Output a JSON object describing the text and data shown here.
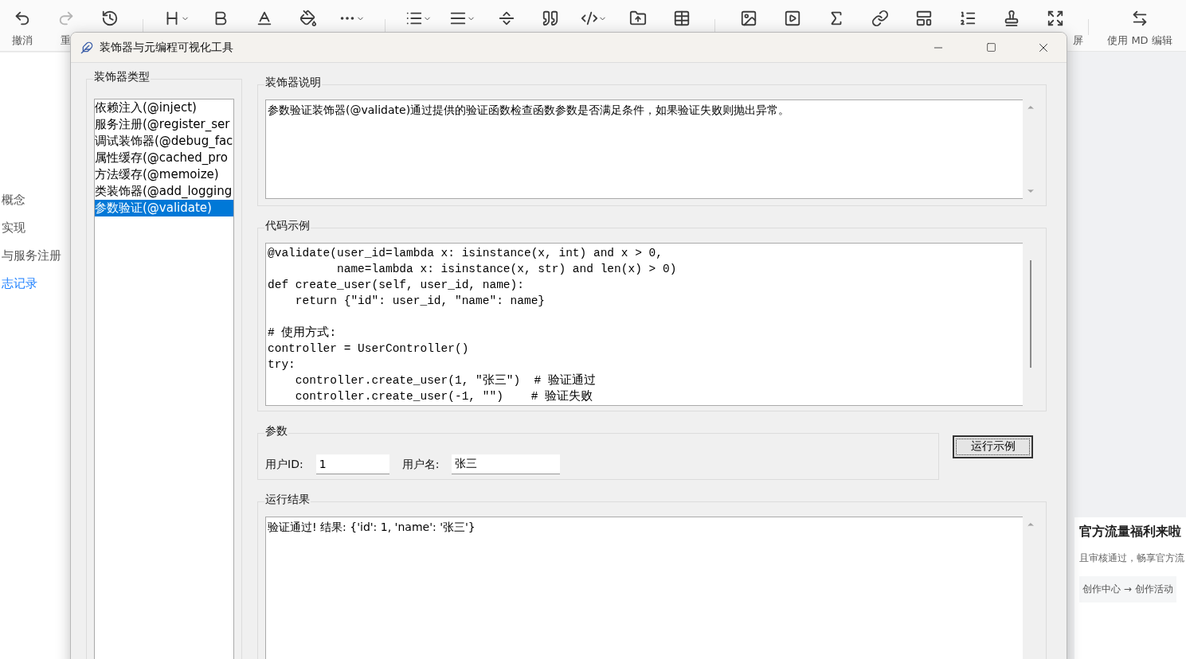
{
  "editor_toolbar": {
    "items": [
      {
        "kind": "undo",
        "label": "撤消",
        "disabled": false,
        "caret": false
      },
      {
        "kind": "redo",
        "label": "重",
        "disabled": true,
        "caret": false
      },
      {
        "kind": "history",
        "disabled": false,
        "caret": false
      },
      {
        "kind": "divider"
      },
      {
        "kind": "heading",
        "disabled": false,
        "caret": true
      },
      {
        "kind": "bold",
        "disabled": false,
        "caret": false
      },
      {
        "kind": "text-color",
        "disabled": false,
        "caret": false
      },
      {
        "kind": "fill",
        "disabled": false,
        "caret": false
      },
      {
        "kind": "more",
        "disabled": false,
        "caret": true
      },
      {
        "kind": "divider"
      },
      {
        "kind": "list",
        "disabled": false,
        "caret": true
      },
      {
        "kind": "align",
        "disabled": false,
        "caret": true
      },
      {
        "kind": "rule",
        "disabled": false,
        "caret": false
      },
      {
        "kind": "quote",
        "disabled": false,
        "caret": false
      },
      {
        "kind": "code",
        "disabled": false,
        "caret": true
      },
      {
        "kind": "upload",
        "disabled": false,
        "caret": false
      },
      {
        "kind": "table",
        "disabled": false,
        "caret": false
      },
      {
        "kind": "divider"
      },
      {
        "kind": "image",
        "disabled": false,
        "caret": false
      },
      {
        "kind": "video",
        "disabled": false,
        "caret": false
      },
      {
        "kind": "formula",
        "disabled": false,
        "caret": false
      },
      {
        "kind": "link",
        "disabled": false,
        "caret": false
      },
      {
        "kind": "template",
        "disabled": false,
        "caret": false
      },
      {
        "kind": "ordered",
        "disabled": false,
        "caret": false
      },
      {
        "kind": "stamp",
        "disabled": false,
        "caret": false
      },
      {
        "kind": "fullscreen",
        "label": "屏",
        "disabled": false,
        "caret": false
      },
      {
        "kind": "divider"
      },
      {
        "kind": "swap",
        "label": "使用 MD 编辑",
        "disabled": false,
        "caret": false
      }
    ]
  },
  "sidebar": {
    "items": [
      {
        "label": "概念",
        "selected": false
      },
      {
        "label": "实现",
        "selected": false
      },
      {
        "label": "与服务注册",
        "selected": false
      },
      {
        "label": "志记录",
        "selected": true
      }
    ]
  },
  "promo": {
    "title": "官方流量福利来啦",
    "text": "且审核通过，畅享官方流",
    "path": "创作中心 → 创作活动"
  },
  "dialog": {
    "title": "装饰器与元编程可视化工具",
    "types": {
      "title": "装饰器类型",
      "items": [
        {
          "label": "依赖注入(@inject)",
          "selected": false
        },
        {
          "label": "服务注册(@register_ser",
          "selected": false
        },
        {
          "label": "调试装饰器(@debug_fac",
          "selected": false
        },
        {
          "label": "属性缓存(@cached_pro",
          "selected": false
        },
        {
          "label": "方法缓存(@memoize)",
          "selected": false
        },
        {
          "label": "类装饰器(@add_logging",
          "selected": false
        },
        {
          "label": "参数验证(@validate)",
          "selected": true
        }
      ]
    },
    "description": {
      "title": "装饰器说明",
      "text": "参数验证装饰器(@validate)通过提供的验证函数检查函数参数是否满足条件，如果验证失败则抛出异常。"
    },
    "code": {
      "title": "代码示例",
      "blocks": [
        [
          "@validate(user_id=lambda x: isinstance(x, int) and x > 0,",
          "          name=lambda x: isinstance(x, str) and len(x) > 0)",
          "def create_user(self, user_id, name):",
          "    return {\"id\": user_id, \"name\": name}"
        ],
        [
          "# 使用方式:",
          "controller = UserController()",
          "try:",
          "    controller.create_user(1, \"张三\")  # 验证通过",
          "    controller.create_user(-1, \"\")    # 验证失败"
        ]
      ]
    },
    "params": {
      "title": "参数",
      "fields": [
        {
          "label": "用户ID:",
          "value": "1"
        },
        {
          "label": "用户名:",
          "value": "张三"
        }
      ]
    },
    "run_button": "运行示例",
    "result": {
      "title": "运行结果",
      "text": "验证通过! 结果: {'id': 1, 'name': '张三'}"
    }
  }
}
